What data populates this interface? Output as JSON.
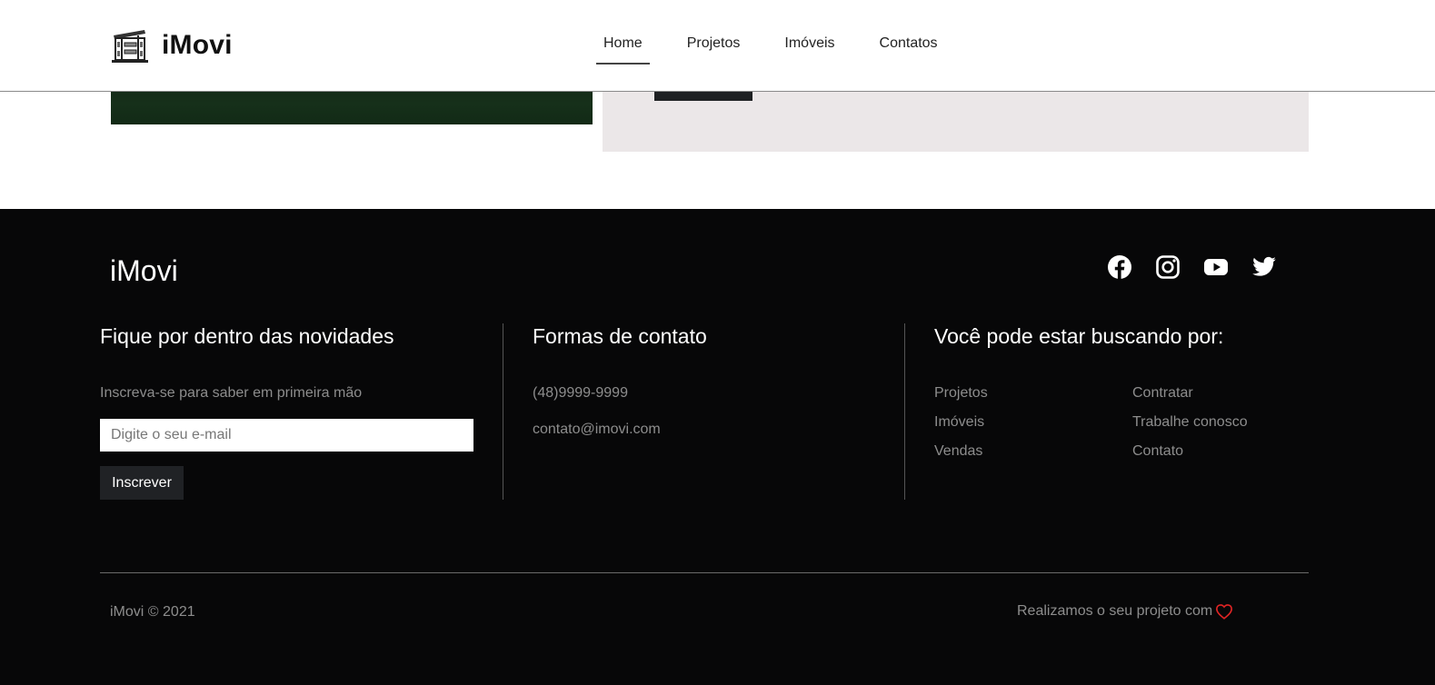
{
  "header": {
    "brand": "iMovi",
    "nav": [
      {
        "label": "Home",
        "active": true
      },
      {
        "label": "Projetos",
        "active": false
      },
      {
        "label": "Imóveis",
        "active": false
      },
      {
        "label": "Contatos",
        "active": false
      }
    ]
  },
  "content": {
    "button_label": ""
  },
  "footer": {
    "logo": "iMovi",
    "social_icons": [
      "facebook-icon",
      "instagram-icon",
      "youtube-icon",
      "twitter-icon"
    ],
    "newsletter": {
      "title": "Fique por dentro das novidades",
      "subtitle": "Inscreva-se para saber em primeira mão",
      "email_placeholder": "Digite o seu e-mail",
      "email_value": "",
      "button_label": "Inscrever"
    },
    "contact": {
      "title": "Formas de contato",
      "phone": "(48)9999-9999",
      "email": "contato@imovi.com"
    },
    "search": {
      "title": "Você pode estar buscando por:",
      "links_left": [
        "Projetos",
        "Imóveis",
        "Vendas"
      ],
      "links_right": [
        "Contratar",
        "Trabalhe conosco",
        "Contato"
      ]
    },
    "copyright": "iMovi © 2021",
    "made_with": "Realizamos o seu projeto com"
  },
  "colors": {
    "footer_bg": "#070708",
    "panel_bg": "#ebe7e8",
    "heart": "#e02424",
    "muted_text": "#8d8d8d"
  }
}
